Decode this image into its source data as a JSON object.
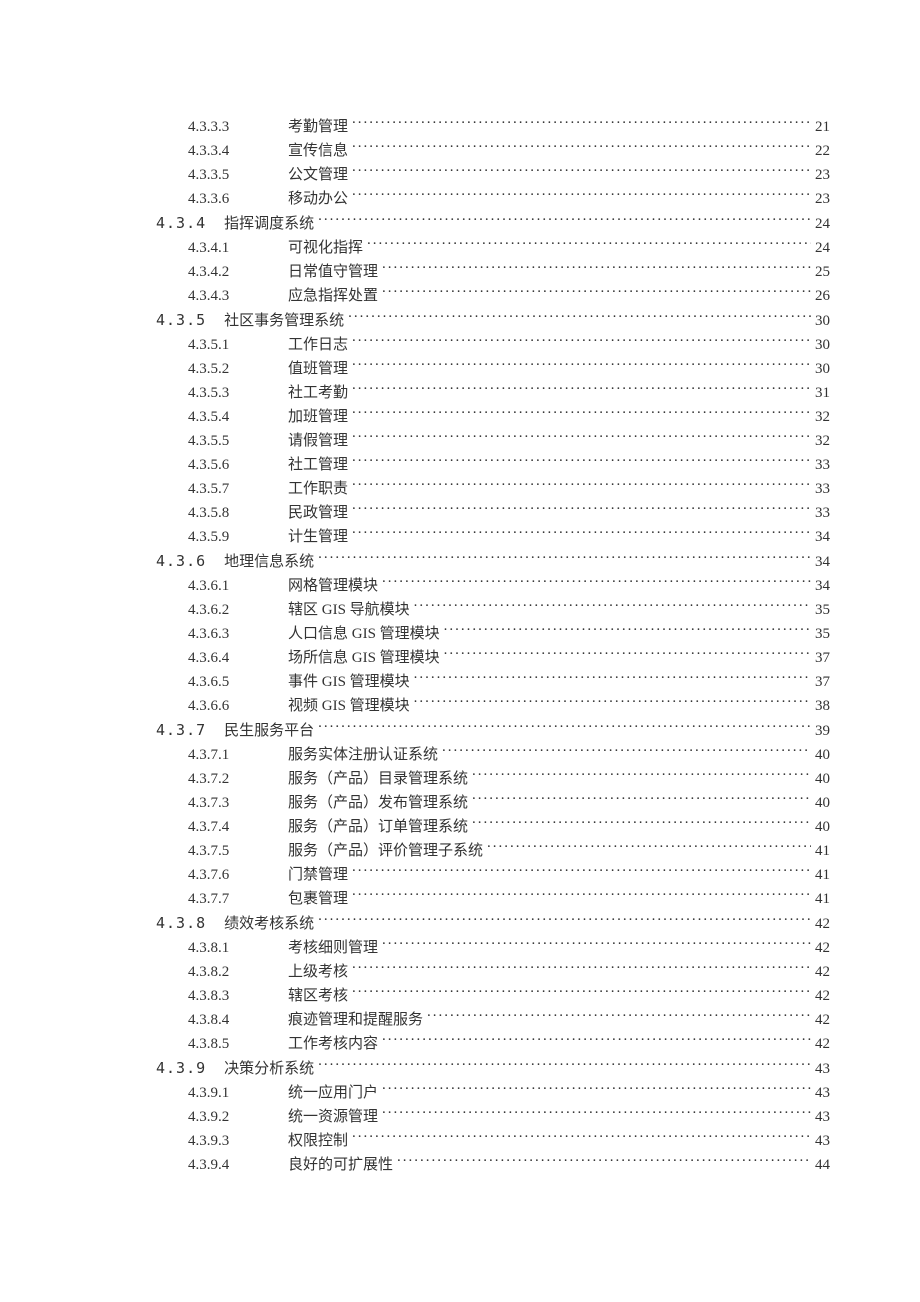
{
  "toc": [
    {
      "level": 3,
      "number": "4.3.3.3",
      "title": "考勤管理",
      "page": "21"
    },
    {
      "level": 3,
      "number": "4.3.3.4",
      "title": "宣传信息",
      "page": "22"
    },
    {
      "level": 3,
      "number": "4.3.3.5",
      "title": "公文管理",
      "page": "23"
    },
    {
      "level": 3,
      "number": "4.3.3.6",
      "title": "移动办公",
      "page": "23"
    },
    {
      "level": 2,
      "number": "4.3.4",
      "title": "指挥调度系统",
      "page": "24"
    },
    {
      "level": 3,
      "number": "4.3.4.1",
      "title": "可视化指挥",
      "page": "24"
    },
    {
      "level": 3,
      "number": "4.3.4.2",
      "title": "日常值守管理",
      "page": "25"
    },
    {
      "level": 3,
      "number": "4.3.4.3",
      "title": "应急指挥处置",
      "page": "26"
    },
    {
      "level": 2,
      "number": "4.3.5",
      "title": "社区事务管理系统",
      "page": "30"
    },
    {
      "level": 3,
      "number": "4.3.5.1",
      "title": "工作日志",
      "page": "30"
    },
    {
      "level": 3,
      "number": "4.3.5.2",
      "title": "值班管理",
      "page": "30"
    },
    {
      "level": 3,
      "number": "4.3.5.3",
      "title": "社工考勤",
      "page": "31"
    },
    {
      "level": 3,
      "number": "4.3.5.4",
      "title": "加班管理",
      "page": "32"
    },
    {
      "level": 3,
      "number": "4.3.5.5",
      "title": "请假管理",
      "page": "32"
    },
    {
      "level": 3,
      "number": "4.3.5.6",
      "title": "社工管理",
      "page": "33"
    },
    {
      "level": 3,
      "number": "4.3.5.7",
      "title": "工作职责",
      "page": "33"
    },
    {
      "level": 3,
      "number": "4.3.5.8",
      "title": "民政管理",
      "page": "33"
    },
    {
      "level": 3,
      "number": "4.3.5.9",
      "title": "计生管理",
      "page": "34"
    },
    {
      "level": 2,
      "number": "4.3.6",
      "title": "地理信息系统",
      "page": "34"
    },
    {
      "level": 3,
      "number": "4.3.6.1",
      "title": "网格管理模块",
      "page": "34"
    },
    {
      "level": 3,
      "number": "4.3.6.2",
      "title": "辖区 GIS 导航模块",
      "page": "35"
    },
    {
      "level": 3,
      "number": "4.3.6.3",
      "title": "人口信息 GIS 管理模块",
      "page": "35"
    },
    {
      "level": 3,
      "number": "4.3.6.4",
      "title": "场所信息 GIS 管理模块",
      "page": "37"
    },
    {
      "level": 3,
      "number": "4.3.6.5",
      "title": "事件 GIS 管理模块",
      "page": "37"
    },
    {
      "level": 3,
      "number": "4.3.6.6",
      "title": "视频 GIS 管理模块",
      "page": "38"
    },
    {
      "level": 2,
      "number": "4.3.7",
      "title": "民生服务平台",
      "page": "39"
    },
    {
      "level": 3,
      "number": "4.3.7.1",
      "title": "服务实体注册认证系统",
      "page": "40"
    },
    {
      "level": 3,
      "number": "4.3.7.2",
      "title": "服务（产品）目录管理系统",
      "page": "40"
    },
    {
      "level": 3,
      "number": "4.3.7.3",
      "title": "服务（产品）发布管理系统",
      "page": "40"
    },
    {
      "level": 3,
      "number": "4.3.7.4",
      "title": "服务（产品）订单管理系统",
      "page": "40"
    },
    {
      "level": 3,
      "number": "4.3.7.5",
      "title": "服务（产品）评价管理子系统",
      "page": "41"
    },
    {
      "level": 3,
      "number": "4.3.7.6",
      "title": "门禁管理",
      "page": "41"
    },
    {
      "level": 3,
      "number": "4.3.7.7",
      "title": "包裹管理",
      "page": "41"
    },
    {
      "level": 2,
      "number": "4.3.8",
      "title": "绩效考核系统",
      "page": "42"
    },
    {
      "level": 3,
      "number": "4.3.8.1",
      "title": "考核细则管理",
      "page": "42"
    },
    {
      "level": 3,
      "number": "4.3.8.2",
      "title": "上级考核",
      "page": "42"
    },
    {
      "level": 3,
      "number": "4.3.8.3",
      "title": "辖区考核",
      "page": "42"
    },
    {
      "level": 3,
      "number": "4.3.8.4",
      "title": "痕迹管理和提醒服务",
      "page": "42"
    },
    {
      "level": 3,
      "number": "4.3.8.5",
      "title": "工作考核内容",
      "page": "42"
    },
    {
      "level": 2,
      "number": "4.3.9",
      "title": "决策分析系统",
      "page": "43"
    },
    {
      "level": 3,
      "number": "4.3.9.1",
      "title": "统一应用门户",
      "page": "43"
    },
    {
      "level": 3,
      "number": "4.3.9.2",
      "title": "统一资源管理",
      "page": "43"
    },
    {
      "level": 3,
      "number": "4.3.9.3",
      "title": "权限控制",
      "page": "43"
    },
    {
      "level": 3,
      "number": "4.3.9.4",
      "title": "良好的可扩展性",
      "page": "44"
    }
  ]
}
